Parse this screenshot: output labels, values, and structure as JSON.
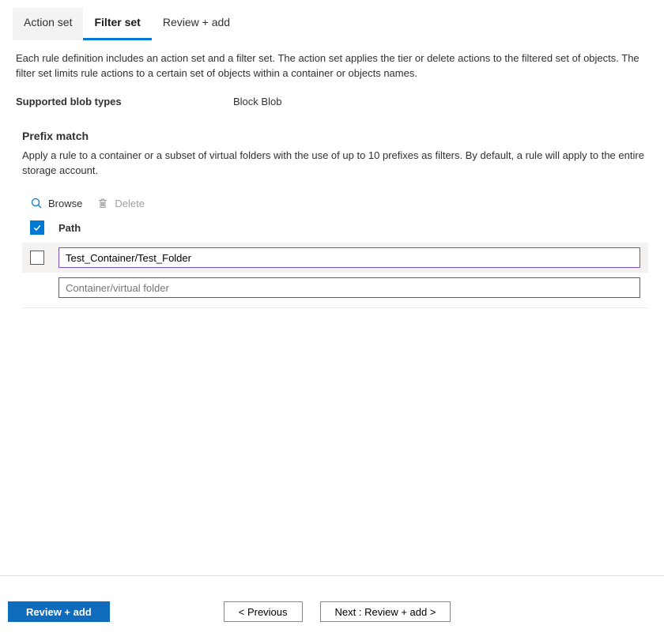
{
  "tabs": {
    "action_set": "Action set",
    "filter_set": "Filter set",
    "review_add": "Review + add"
  },
  "description": "Each rule definition includes an action set and a filter set. The action set applies the tier or delete actions to the filtered set of objects. The filter set limits rule actions to a certain set of objects within a container or objects names.",
  "blob_types_label": "Supported blob types",
  "blob_types_value": "Block Blob",
  "prefix": {
    "title": "Prefix match",
    "desc": "Apply a rule to a container or a subset of virtual folders with the use of up to 10 prefixes as filters. By default, a rule will apply to the entire storage account.",
    "browse": "Browse",
    "delete": "Delete",
    "col_path": "Path",
    "rows": [
      {
        "value": "Test_Container/Test_Folder"
      }
    ],
    "placeholder": "Container/virtual folder"
  },
  "footer": {
    "review_add": "Review + add",
    "previous": "<  Previous",
    "next": "Next : Review + add  >"
  }
}
